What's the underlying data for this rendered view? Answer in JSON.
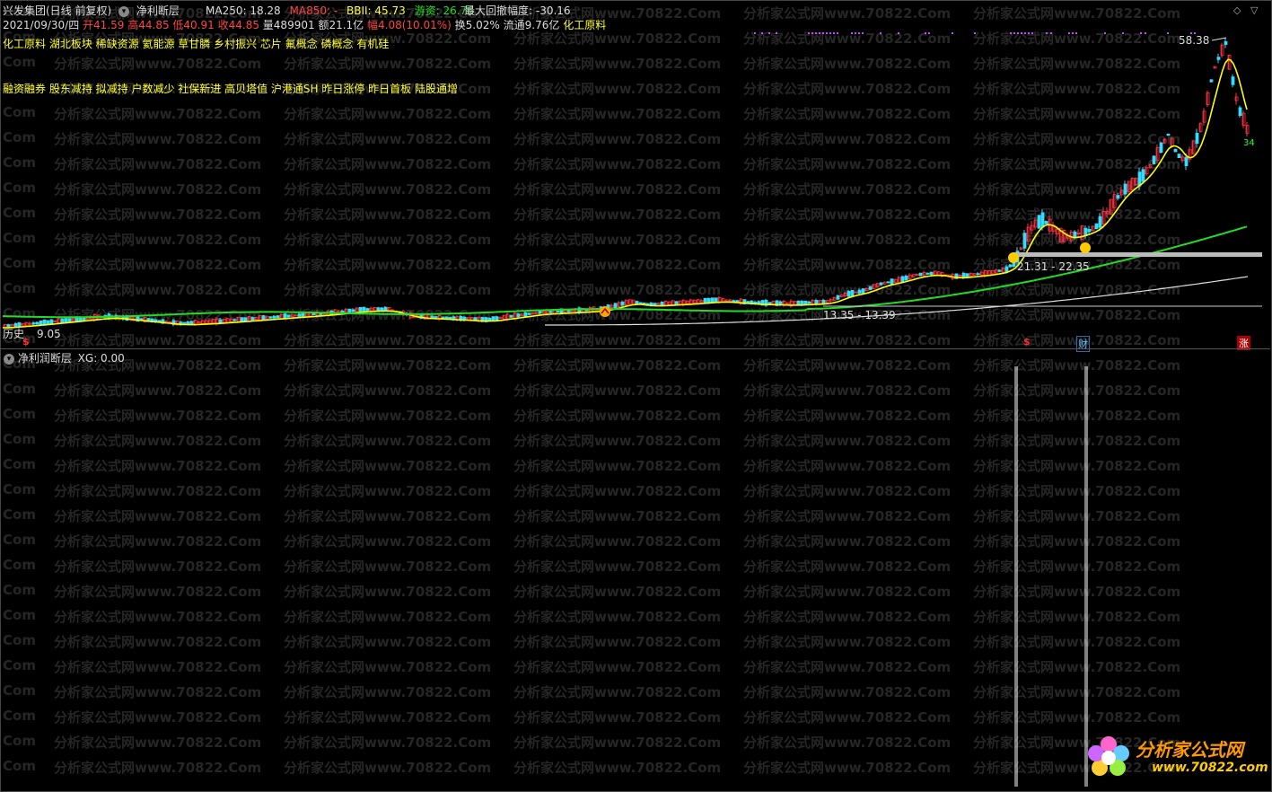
{
  "header": {
    "stock": "兴发集团(日线 前复权)",
    "indicator": "净利断层",
    "ma250_label": "MA250: 18.28",
    "ma850_label": "MA850: -",
    "bbii_label": "BBII: 45.73",
    "youzi_label": "游资: 26.76",
    "drawdown_label": "最大回撤幅度: -30.16"
  },
  "quote": {
    "date": "2021/09/30/四",
    "open": "开41.59",
    "high": "高44.85",
    "low": "低40.91",
    "close": "收44.85",
    "volume": "量489901",
    "amount": "额21.1亿",
    "change": "幅4.08(10.01%)",
    "turnover": "换5.02%",
    "float": "流通9.76亿",
    "sector": "化工原料"
  },
  "concepts": {
    "line1": "化工原料 湖北板块 稀缺资源 氦能源 草甘膦 乡村振兴 芯片 氟概念 磷概念 有机硅",
    "line2": "融资融券 股东减持 拟减持 户数减少 社保新进 高贝塔值 沪港通SH 昨日涨停 昨日首板 陆股通增"
  },
  "annotations": {
    "peak": "58.38",
    "range1": "21.31 - 22.35",
    "range2": "13.35 - 13.39",
    "low_left": "9.05",
    "low_left_prefix": "历史",
    "last_close_mark": "34"
  },
  "markers": {
    "s1": "$",
    "s2": "$",
    "cai": "财",
    "zhang": "涨"
  },
  "sub_header": {
    "title": "净利润断层",
    "value": "XG: 0.00"
  },
  "watermark": {
    "text": "分析家公式网www.70822.Com",
    "left_fragment": "Com"
  },
  "logo": {
    "name": "分析家公式网",
    "url": "www.70822.com"
  },
  "colors": {
    "background": "#000000",
    "up": "#ff3344",
    "down": "#33ddff",
    "ma_yellow": "#ffff00",
    "ma_green": "#22dd22",
    "ma_white": "#dddddd",
    "gray_band": "#bbbbbb"
  }
}
